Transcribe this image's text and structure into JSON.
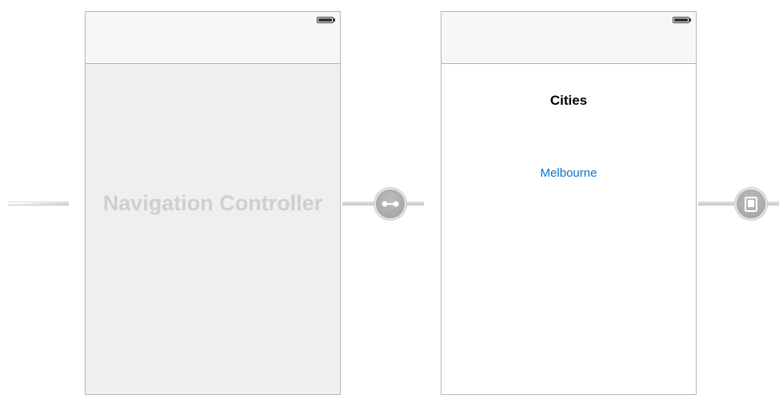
{
  "navigation_controller": {
    "placeholder": "Navigation Controller"
  },
  "view_controller": {
    "title": "Cities",
    "button_label": "Melbourne"
  },
  "segues": {
    "root": "root-view-controller-relationship-icon",
    "push": "modal-device-segue-icon"
  },
  "colors": {
    "button_tint": "#0a70d0",
    "placeholder_text": "#cfcfcf",
    "scene_border": "#b8b8b8"
  }
}
